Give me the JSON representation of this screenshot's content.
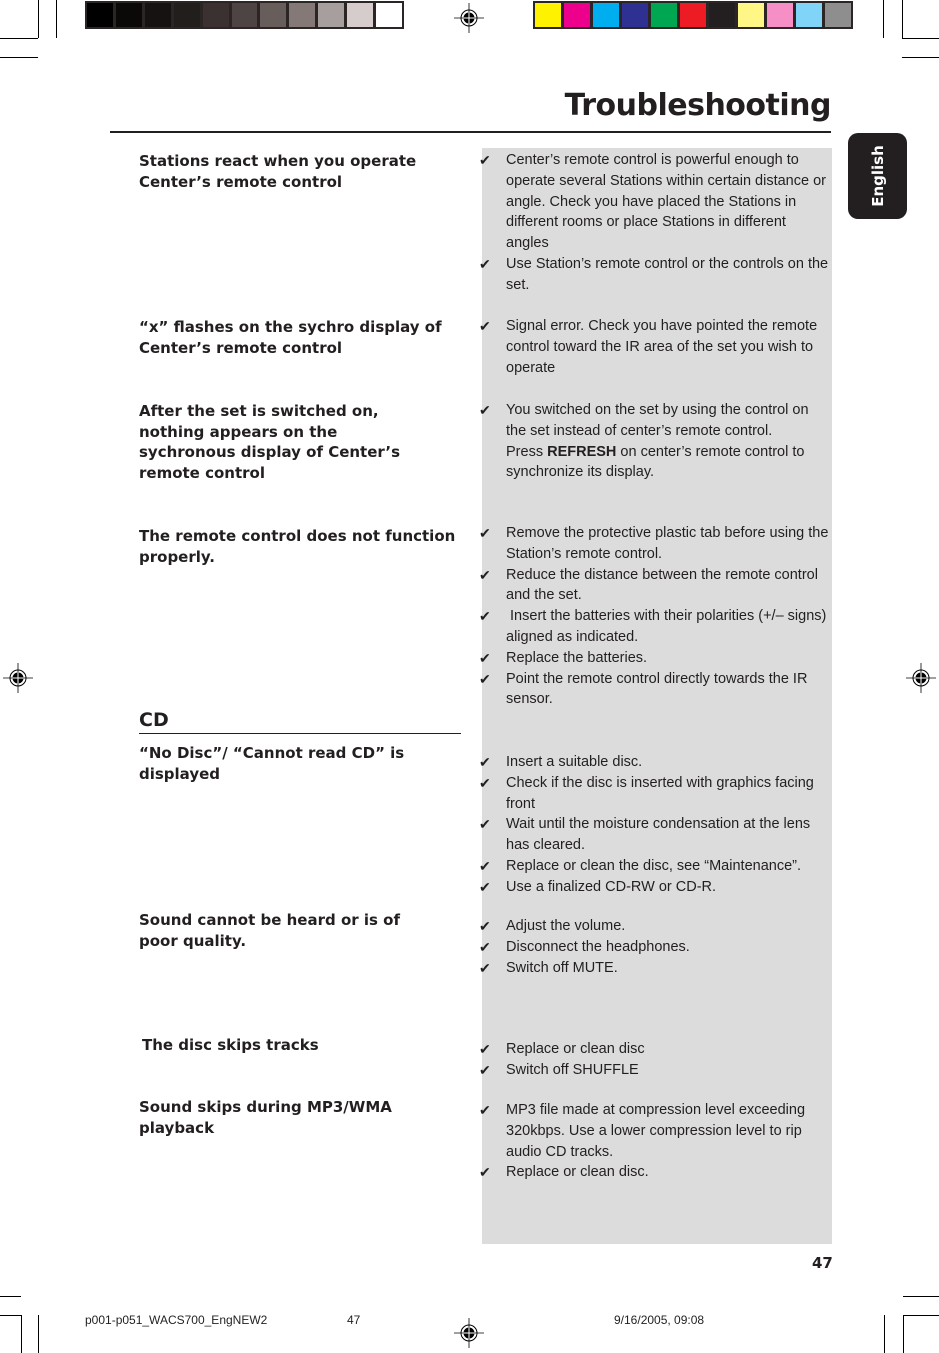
{
  "header": {
    "title": "Troubleshooting",
    "language_tab": "English"
  },
  "print_marks": {
    "gray_swatches": [
      "#000000",
      "#0b0908",
      "#151211",
      "#221e1c",
      "#3a3130",
      "#4d4443",
      "#675e5c",
      "#847977",
      "#a69f9d",
      "#d6cccc",
      "#ffffff"
    ],
    "color_swatches": [
      "#fff200",
      "#ec008c",
      "#00aeef",
      "#2e3192",
      "#00a651",
      "#ed1c24",
      "#231f20",
      "#fff685",
      "#f68fc6",
      "#7fd4f7",
      "#8e8e8e"
    ]
  },
  "sections": {
    "stations": {
      "problems": [
        {
          "problem": "Stations react when you operate Center’s remote control",
          "solutions": [
            "Center’s remote control is powerful enough to operate several Stations within certain distance or angle. Check you have placed the Stations in different rooms or place Stations in different angles",
            "Use Station’s remote control or the controls on the set."
          ]
        },
        {
          "problem": "“x” flashes on the sychro display of Center’s remote control",
          "solutions": [
            "Signal error. Check you have pointed the remote control toward the IR area of the set you wish to operate"
          ]
        },
        {
          "problem": "After the set is switched on, nothing appears on the sychronous display of Center’s remote control",
          "solutions_rich": {
            "line1": "You switched on the set by using the control on the set instead of center’s remote control.",
            "press_word": "Press ",
            "bold_word": "REFRESH",
            "rest": " on center’s remote control to synchronize its display."
          }
        },
        {
          "problem": "The remote control does not function properly.",
          "solutions": [
            "Remove the protective plastic tab before using the Station’s remote control.",
            "Reduce the distance between the remote control and the set.",
            " Insert the batteries with their polarities (+/– signs) aligned as indicated.",
            "Replace the batteries.",
            "Point the remote control directly towards the IR sensor."
          ]
        }
      ]
    },
    "cd": {
      "heading": "CD",
      "problems": [
        {
          "problem": "“No Disc”/ “Cannot read CD” is displayed",
          "solutions": [
            "Insert a suitable disc.",
            "Check if the disc is inserted with graphics facing front",
            "Wait until the moisture condensation at the lens has cleared.",
            "Replace or clean the disc, see “Maintenance”.",
            "Use a finalized CD-RW or CD-R."
          ]
        },
        {
          "problem": "Sound cannot be heard or is of poor quality.",
          "solutions": [
            "Adjust the volume.",
            "Disconnect the headphones.",
            "Switch off MUTE."
          ]
        },
        {
          "problem": "The disc skips tracks",
          "solutions": [
            "Replace or clean disc",
            "Switch off SHUFFLE"
          ]
        },
        {
          "problem": "Sound skips during MP3/WMA playback",
          "solutions": [
            "MP3 file made at compression level exceeding 320kbps. Use a lower compression level to rip audio CD tracks.",
            "Replace or clean disc."
          ]
        }
      ]
    }
  },
  "check_icon": "✔",
  "page_number": "47",
  "footer": {
    "filename": "p001-p051_WACS700_EngNEW2",
    "page": "47",
    "timestamp": "9/16/2005, 09:08"
  }
}
